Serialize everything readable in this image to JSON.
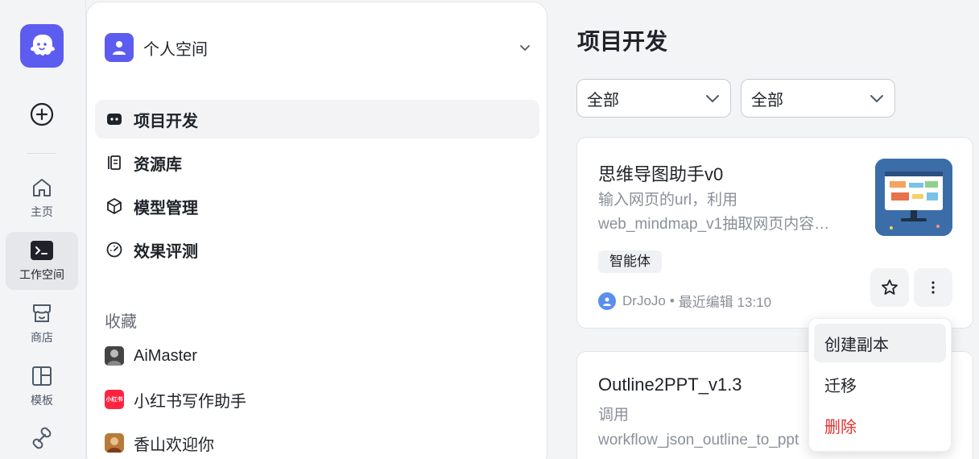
{
  "rail": {
    "items": [
      {
        "label": "主页",
        "icon": "home-icon"
      },
      {
        "label": "工作空间",
        "icon": "terminal-icon"
      },
      {
        "label": "商店",
        "icon": "store-icon"
      },
      {
        "label": "模板",
        "icon": "template-icon"
      }
    ]
  },
  "panel": {
    "space_name": "个人空间",
    "nav": [
      {
        "label": "项目开发",
        "icon": "bot-icon"
      },
      {
        "label": "资源库",
        "icon": "library-icon"
      },
      {
        "label": "模型管理",
        "icon": "cube-icon"
      },
      {
        "label": "效果评测",
        "icon": "gauge-icon"
      }
    ],
    "favorites_title": "收藏",
    "favorites": [
      {
        "label": "AiMaster",
        "thumb_text": ""
      },
      {
        "label": "小红书写作助手",
        "thumb_text": "小红书"
      },
      {
        "label": "香山欢迎你",
        "thumb_text": ""
      }
    ]
  },
  "main": {
    "title": "项目开发",
    "filters": [
      {
        "value": "全部"
      },
      {
        "value": "全部"
      }
    ],
    "cards": [
      {
        "title": "思维导图助手v0",
        "desc_line1": "输入网页的url，利用",
        "desc_line2": "web_mindmap_v1抽取网页内容…",
        "tag": "智能体",
        "author": "DrJoJo",
        "meta_sep": "•",
        "edited": "最近编辑 13:10"
      },
      {
        "title": "Outline2PPT_v1.3",
        "desc_line1": "调用",
        "desc_line2": "workflow_json_outline_to_ppt"
      }
    ]
  },
  "menu": {
    "items": [
      {
        "label": "创建副本"
      },
      {
        "label": "迁移"
      },
      {
        "label": "删除"
      }
    ]
  },
  "colors": {
    "brand": "#5d5cf0",
    "danger": "#e0302e"
  }
}
